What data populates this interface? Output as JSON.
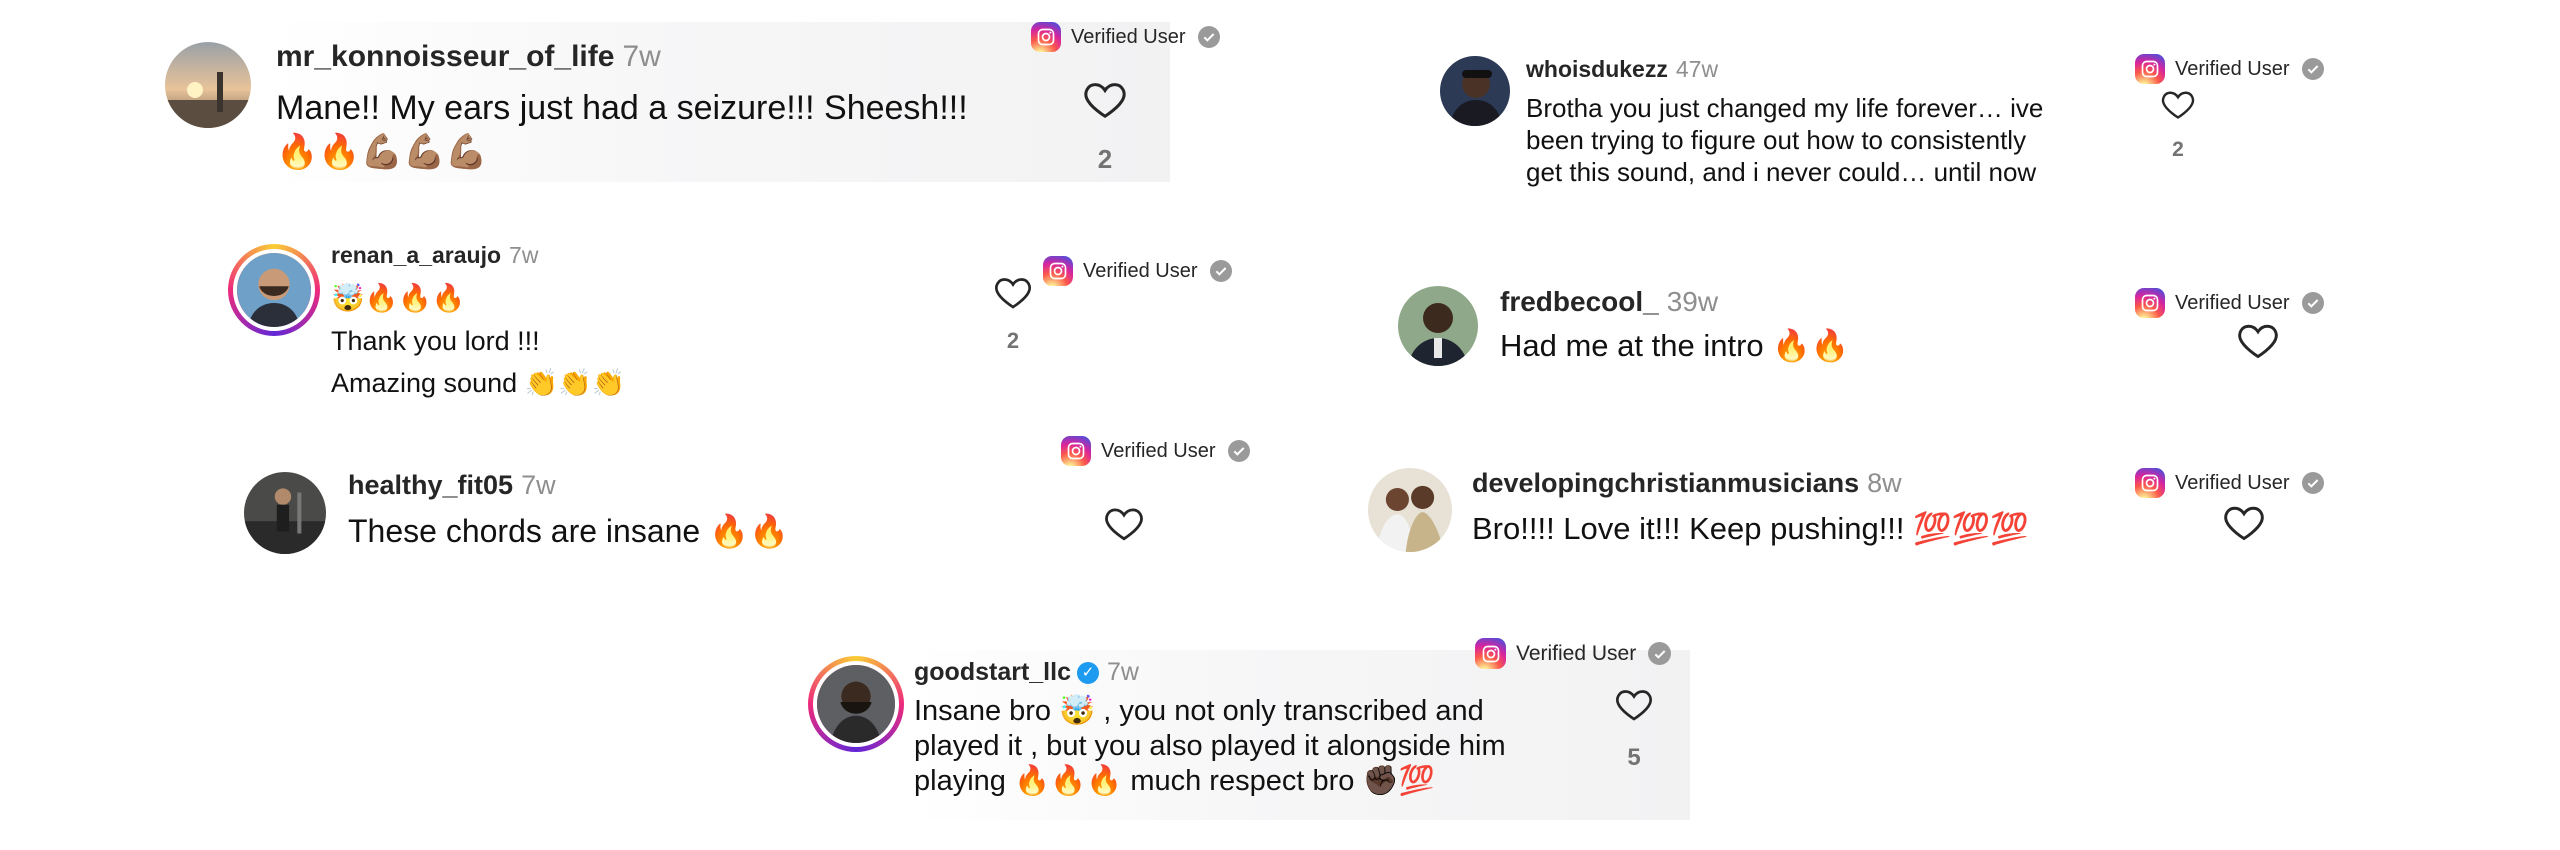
{
  "badge_label": "Verified User",
  "colors": {
    "username": "#262626",
    "timestamp": "#8e8e8e",
    "verified_blue": "#1d9bf0"
  },
  "comments": [
    {
      "username": "mr_konnoisseur_of_life",
      "time": "7w",
      "lines": [
        "Mane!! My ears just had a seizure!!! Sheesh!!!",
        "🔥🔥💪🏽💪🏽💪🏽"
      ],
      "likes": "2",
      "avatar": "sunset-photo"
    },
    {
      "username": "whoisdukezz",
      "time": "47w",
      "lines": [
        "Brotha you just changed my life forever… ive",
        "been trying to figure out how to consistently",
        "get this sound, and i never could… until now"
      ],
      "likes": "2",
      "avatar": "user-photo"
    },
    {
      "username": "renan_a_araujo",
      "time": "7w",
      "lines": [
        "🤯🔥🔥🔥",
        "Thank you lord !!!",
        "Amazing sound 👏👏👏"
      ],
      "likes": "2",
      "avatar": "user-photo"
    },
    {
      "username": "fredbecool_",
      "time": "39w",
      "lines": [
        "Had me at the intro 🔥🔥"
      ],
      "likes": "",
      "avatar": "user-photo"
    },
    {
      "username": "healthy_fit05",
      "time": "7w",
      "lines": [
        "These chords are insane 🔥🔥"
      ],
      "likes": "",
      "avatar": "user-photo"
    },
    {
      "username": "developingchristianmusicians",
      "time": "8w",
      "lines": [
        "Bro!!!! Love it!!! Keep pushing!!! 💯💯💯"
      ],
      "likes": "",
      "avatar": "user-photo"
    },
    {
      "username": "goodstart_llc",
      "time": "7w",
      "verified": true,
      "lines": [
        "Insane bro 🤯 , you not only transcribed and",
        "played it , but you also played it alongside him",
        "playing 🔥🔥🔥 much respect bro ✊🏿💯"
      ],
      "likes": "5",
      "avatar": "user-photo"
    }
  ]
}
